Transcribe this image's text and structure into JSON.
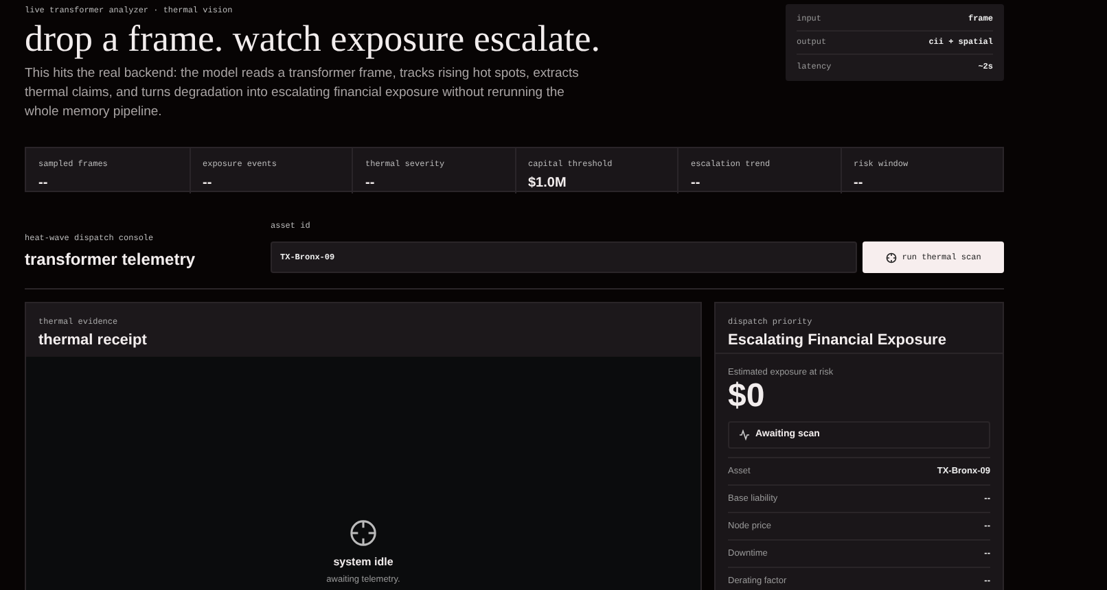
{
  "eyebrow": "live transformer analyzer · thermal vision",
  "title": "drop a frame. watch exposure escalate.",
  "description": "This hits the real backend: the model reads a transformer frame, tracks rising hot spots, extracts thermal claims, and turns degradation into escalating financial exposure without rerunning the whole memory pipeline.",
  "spec": [
    {
      "label": "input",
      "value": "frame"
    },
    {
      "label": "output",
      "value": "cii + spatial"
    },
    {
      "label": "latency",
      "value": "~2s"
    }
  ],
  "stats": [
    {
      "label": "sampled frames",
      "value": "--"
    },
    {
      "label": "exposure events",
      "value": "--"
    },
    {
      "label": "thermal severity",
      "value": "--"
    },
    {
      "label": "capital threshold",
      "value": "$1.0M"
    },
    {
      "label": "escalation trend",
      "value": "--"
    },
    {
      "label": "risk window",
      "value": "--"
    }
  ],
  "console": {
    "eyebrow": "heat-wave dispatch console",
    "title": "transformer telemetry",
    "field_label": "asset id",
    "field_value": "TX-Bronx-09",
    "button": "run thermal scan"
  },
  "evidence": {
    "eyebrow": "thermal evidence",
    "title": "thermal receipt",
    "status": "system idle",
    "hint": "awaiting telemetry."
  },
  "priority": {
    "eyebrow": "dispatch priority",
    "title": "Escalating Financial Exposure",
    "amount_label": "Estimated exposure at risk",
    "amount": "$0",
    "status": "Awaiting scan",
    "rows": [
      {
        "label": "Asset",
        "value": "TX-Bronx-09"
      },
      {
        "label": "Base liability",
        "value": "--"
      },
      {
        "label": "Node price",
        "value": "--"
      },
      {
        "label": "Downtime",
        "value": "--"
      },
      {
        "label": "Derating factor",
        "value": "--"
      }
    ]
  }
}
